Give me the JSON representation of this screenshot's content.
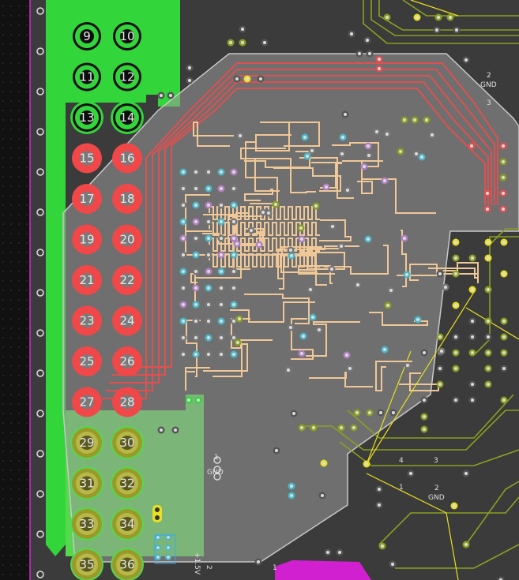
{
  "app": {
    "title": "PCB layout view"
  },
  "colors": {
    "background": "#3b3b3b",
    "copper_green": "#33d63a",
    "copper_light_green": "#55d84e",
    "pad_red": "#f04848",
    "pad_olive": "#9a9a2a",
    "zone_overlay": "#8a8a8a",
    "trace_red": "#e05050",
    "trace_tan": "#f0c898",
    "trace_olive": "#8aa020",
    "trace_yellow": "#e8e020",
    "keepout_magenta": "#d020d0"
  },
  "header_pins": [
    {
      "label": "9",
      "type": "green"
    },
    {
      "label": "10",
      "type": "green"
    },
    {
      "label": "11",
      "type": "green"
    },
    {
      "label": "12",
      "type": "green"
    },
    {
      "label": "13",
      "type": "green"
    },
    {
      "label": "14",
      "type": "green"
    },
    {
      "label": "15",
      "type": "red"
    },
    {
      "label": "16",
      "type": "red"
    },
    {
      "label": "17",
      "type": "red"
    },
    {
      "label": "18",
      "type": "red"
    },
    {
      "label": "19",
      "type": "red"
    },
    {
      "label": "20",
      "type": "red"
    },
    {
      "label": "21",
      "type": "red"
    },
    {
      "label": "22",
      "type": "red"
    },
    {
      "label": "23",
      "type": "red"
    },
    {
      "label": "24",
      "type": "red"
    },
    {
      "label": "25",
      "type": "red"
    },
    {
      "label": "26",
      "type": "red"
    },
    {
      "label": "27",
      "type": "red"
    },
    {
      "label": "28",
      "type": "red"
    },
    {
      "label": "29",
      "type": "olive"
    },
    {
      "label": "30",
      "type": "olive"
    },
    {
      "label": "31",
      "type": "olive"
    },
    {
      "label": "32",
      "type": "olive"
    },
    {
      "label": "33",
      "type": "olive"
    },
    {
      "label": "34",
      "type": "olive"
    },
    {
      "label": "35",
      "type": "olive"
    },
    {
      "label": "36",
      "type": "olive"
    }
  ],
  "silkscreen": {
    "gnd_top_right_num": "2",
    "gnd_top_right": "GND",
    "top_right_3": "3",
    "center_num": "1",
    "center_gnd": "GND",
    "bottom_4": "4",
    "bottom_3": "3",
    "bottom_1": "1",
    "bottom_2": "2",
    "bottom_gnd": "GND",
    "bottom_left_text": "+1.5V",
    "bottom_left_num": "2",
    "bottom_magenta_num": "1"
  }
}
